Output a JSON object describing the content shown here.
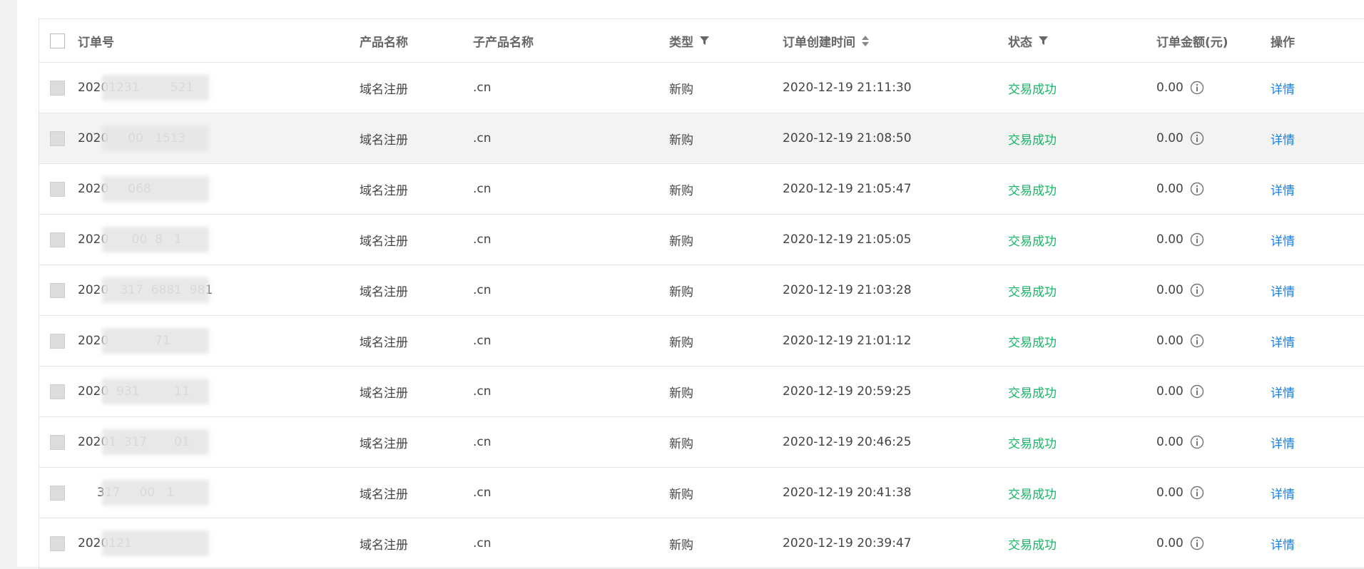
{
  "table": {
    "headers": {
      "order_id": "订单号",
      "product": "产品名称",
      "sub_product": "子产品名称",
      "type": "类型",
      "created": "订单创建时间",
      "status": "状态",
      "amount": "订单金额(元)",
      "action": "操作"
    },
    "rows": [
      {
        "order_id": "20201231        521",
        "product": "域名注册",
        "sub_product": ".cn",
        "type": "新购",
        "created": "2020-12-19 21:11:30",
        "status": "交易成功",
        "amount": "0.00",
        "action": "详情"
      },
      {
        "order_id": "2020     00   1513",
        "product": "域名注册",
        "sub_product": ".cn",
        "type": "新购",
        "created": "2020-12-19 21:08:50",
        "status": "交易成功",
        "amount": "0.00",
        "action": "详情"
      },
      {
        "order_id": "2020     068      ",
        "product": "域名注册",
        "sub_product": ".cn",
        "type": "新购",
        "created": "2020-12-19 21:05:47",
        "status": "交易成功",
        "amount": "0.00",
        "action": "详情"
      },
      {
        "order_id": "2020      00  8   1",
        "product": "域名注册",
        "sub_product": ".cn",
        "type": "新购",
        "created": "2020-12-19 21:05:05",
        "status": "交易成功",
        "amount": "0.00",
        "action": "详情"
      },
      {
        "order_id": "2020   317  6881  981",
        "product": "域名注册",
        "sub_product": ".cn",
        "type": "新购",
        "created": "2020-12-19 21:03:28",
        "status": "交易成功",
        "amount": "0.00",
        "action": "详情"
      },
      {
        "order_id": "2020            71",
        "product": "域名注册",
        "sub_product": ".cn",
        "type": "新购",
        "created": "2020-12-19 21:01:12",
        "status": "交易成功",
        "amount": "0.00",
        "action": "详情"
      },
      {
        "order_id": "2020  931         11",
        "product": "域名注册",
        "sub_product": ".cn",
        "type": "新购",
        "created": "2020-12-19 20:59:25",
        "status": "交易成功",
        "amount": "0.00",
        "action": "详情"
      },
      {
        "order_id": "20201  317       01",
        "product": "域名注册",
        "sub_product": ".cn",
        "type": "新购",
        "created": "2020-12-19 20:46:25",
        "status": "交易成功",
        "amount": "0.00",
        "action": "详情"
      },
      {
        "order_id": "     317     00   1",
        "product": "域名注册",
        "sub_product": ".cn",
        "type": "新购",
        "created": "2020-12-19 20:41:38",
        "status": "交易成功",
        "amount": "0.00",
        "action": "详情"
      },
      {
        "order_id": "2020121           ",
        "product": "域名注册",
        "sub_product": ".cn",
        "type": "新购",
        "created": "2020-12-19 20:39:47",
        "status": "交易成功",
        "amount": "0.00",
        "action": "详情"
      }
    ]
  },
  "colors": {
    "status_success": "#18b566",
    "link": "#1d7fe0"
  },
  "icons": {
    "filter": "filter-icon",
    "sort": "sort-icon",
    "info": "info-icon"
  }
}
